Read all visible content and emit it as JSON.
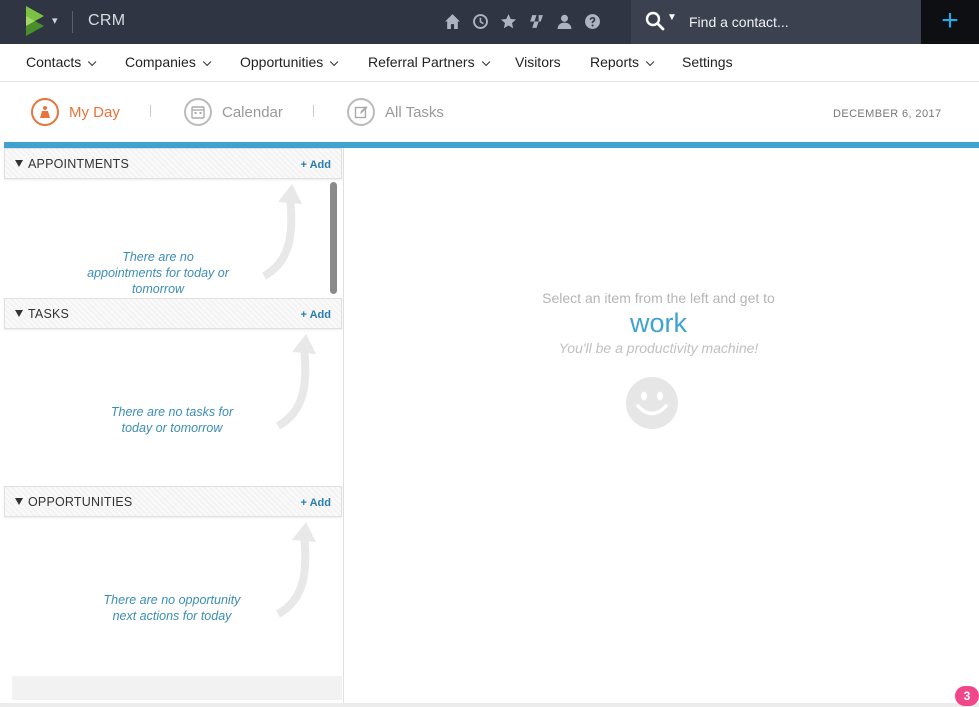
{
  "app": {
    "name": "CRM"
  },
  "search": {
    "placeholder": "Find a contact..."
  },
  "header": {
    "add_label": "+"
  },
  "nav": {
    "items": [
      {
        "label": "Contacts",
        "dropdown": true
      },
      {
        "label": "Companies",
        "dropdown": true
      },
      {
        "label": "Opportunities",
        "dropdown": true
      },
      {
        "label": "Referral Partners",
        "dropdown": true
      },
      {
        "label": "Visitors",
        "dropdown": false
      },
      {
        "label": "Reports",
        "dropdown": true
      },
      {
        "label": "Settings",
        "dropdown": false
      }
    ]
  },
  "subtabs": [
    {
      "label": "My Day",
      "icon": "my-day-icon",
      "active": true
    },
    {
      "label": "Calendar",
      "icon": "calendar-icon",
      "active": false
    },
    {
      "label": "All Tasks",
      "icon": "edit-icon",
      "active": false
    }
  ],
  "date": "DECEMBER 6, 2017",
  "sections": {
    "appointments": {
      "title": "APPOINTMENTS",
      "add": "+ Add",
      "empty": [
        "There are no",
        "appointments for today or",
        "tomorrow"
      ]
    },
    "tasks": {
      "title": "TASKS",
      "add": "+ Add",
      "empty": [
        "There are no tasks for",
        "today or tomorrow"
      ]
    },
    "opportunities": {
      "title": "OPPORTUNITIES",
      "add": "+ Add",
      "empty": [
        "There are no opportunity",
        "next actions for today"
      ]
    }
  },
  "main": {
    "line1": "Select an item from the left and get to",
    "line2": "work",
    "line3": "You'll be a productivity machine!"
  },
  "badge": "3",
  "colors": {
    "accent": "#3fa3cf",
    "active_tab": "#e8733c",
    "topbar": "#2f3542",
    "badge": "#f0478a"
  }
}
